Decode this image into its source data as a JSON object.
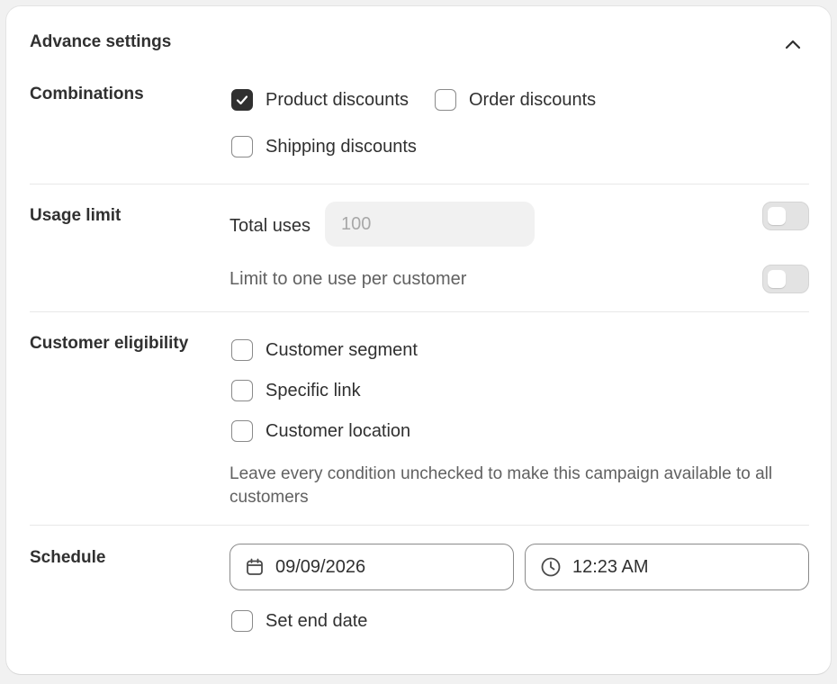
{
  "header": {
    "title": "Advance settings",
    "collapse_icon": "chevron-up-icon"
  },
  "combinations": {
    "label": "Combinations",
    "options": [
      {
        "label": "Product discounts",
        "checked": true
      },
      {
        "label": "Order discounts",
        "checked": false
      },
      {
        "label": "Shipping discounts",
        "checked": false
      }
    ]
  },
  "usage_limit": {
    "label": "Usage limit",
    "total_uses_label": "Total uses",
    "total_uses_placeholder": "100",
    "total_uses_enabled": false,
    "one_per_customer_label": "Limit to one use per customer",
    "one_per_customer_enabled": false
  },
  "customer_eligibility": {
    "label": "Customer eligibility",
    "options": [
      {
        "label": "Customer segment",
        "checked": false
      },
      {
        "label": "Specific link",
        "checked": false
      },
      {
        "label": "Customer location",
        "checked": false
      }
    ],
    "help_text": "Leave every condition unchecked to make this campaign available to all customers"
  },
  "schedule": {
    "label": "Schedule",
    "date_value": "09/09/2026",
    "date_icon": "calendar-icon",
    "time_value": "12:23 AM",
    "time_icon": "clock-icon",
    "end_date_label": "Set end date",
    "end_date_checked": false
  },
  "colors": {
    "text": "#303030",
    "muted": "#616161",
    "checked_fill": "#303030",
    "border": "#8a8a8a"
  }
}
